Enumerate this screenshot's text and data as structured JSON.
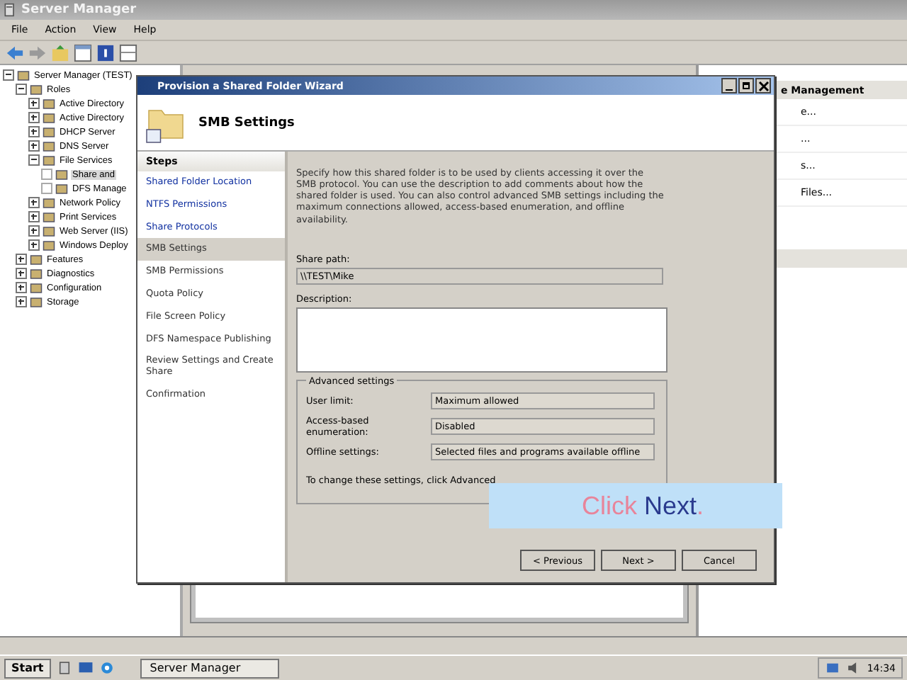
{
  "window": {
    "title": "Server Manager"
  },
  "menu": [
    "File",
    "Action",
    "View",
    "Help"
  ],
  "tree": [
    {
      "label": "Server Manager (TEST)",
      "expanded": true,
      "children": [
        {
          "label": "Roles",
          "expanded": true,
          "children": [
            {
              "label": "Active Directory",
              "expanded": false
            },
            {
              "label": "Active Directory",
              "expanded": false
            },
            {
              "label": "DHCP Server",
              "expanded": false
            },
            {
              "label": "DNS Server",
              "expanded": false
            },
            {
              "label": "File Services",
              "expanded": true,
              "children": [
                {
                  "label": "Share and",
                  "selected": true
                },
                {
                  "label": "DFS Manage",
                  "selected": false
                }
              ]
            },
            {
              "label": "Network Policy",
              "expanded": false
            },
            {
              "label": "Print Services",
              "expanded": false
            },
            {
              "label": "Web Server (IIS)",
              "expanded": false
            },
            {
              "label": "Windows Deploy",
              "expanded": false
            }
          ]
        },
        {
          "label": "Features",
          "expanded": false
        },
        {
          "label": "Diagnostics",
          "expanded": false
        },
        {
          "label": "Configuration",
          "expanded": false
        },
        {
          "label": "Storage",
          "expanded": false
        }
      ]
    }
  ],
  "actions": {
    "header": "e Management",
    "items": [
      "e...",
      "...",
      "s...",
      "Files..."
    ]
  },
  "wizard": {
    "title": "Provision a Shared Folder Wizard",
    "heading": "SMB Settings",
    "steps_header": "Steps",
    "steps": [
      {
        "label": "Shared Folder Location",
        "selected": false,
        "done": true
      },
      {
        "label": "NTFS Permissions",
        "selected": false,
        "done": true
      },
      {
        "label": "Share Protocols",
        "selected": false,
        "done": true
      },
      {
        "label": "SMB Settings",
        "selected": true,
        "done": false
      },
      {
        "label": "SMB Permissions",
        "selected": false,
        "done": false
      },
      {
        "label": "Quota Policy",
        "selected": false,
        "done": false
      },
      {
        "label": "File Screen Policy",
        "selected": false,
        "done": false
      },
      {
        "label": "DFS Namespace Publishing",
        "selected": false,
        "done": false
      },
      {
        "label": "Review Settings and Create Share",
        "selected": false,
        "done": false
      },
      {
        "label": "Confirmation",
        "selected": false,
        "done": false
      }
    ],
    "intro": "Specify how this shared folder is to be used by clients accessing it over the SMB protocol. You can use the description to add comments about how the shared folder is used. You can also control advanced SMB settings including the maximum connections allowed, access-based enumeration, and offline availability.",
    "share_path": {
      "label": "Share path:",
      "value": "\\\\TEST\\Mike"
    },
    "description": {
      "label": "Description:"
    },
    "advanced": {
      "title": "Advanced settings",
      "rows": [
        {
          "label": "User limit:",
          "value": "Maximum allowed"
        },
        {
          "label": "Access-based enumeration:",
          "value": "Disabled"
        },
        {
          "label": "Offline settings:",
          "value": "Selected files and programs available offline"
        }
      ],
      "note": "To change these settings, click Advanced"
    },
    "buttons": [
      {
        "label": "< Previous"
      },
      {
        "label": "Next >"
      },
      {
        "label": "Cancel"
      }
    ]
  },
  "callout": {
    "parts": [
      {
        "text": "Click",
        "color": "#e8849a"
      },
      {
        "text": "Next",
        "color": "#2a3a8e"
      },
      {
        "text": ".",
        "color": "#e8849a"
      }
    ]
  },
  "taskbar": {
    "start": "Start",
    "task": "Server Manager",
    "clock": "14:34"
  }
}
